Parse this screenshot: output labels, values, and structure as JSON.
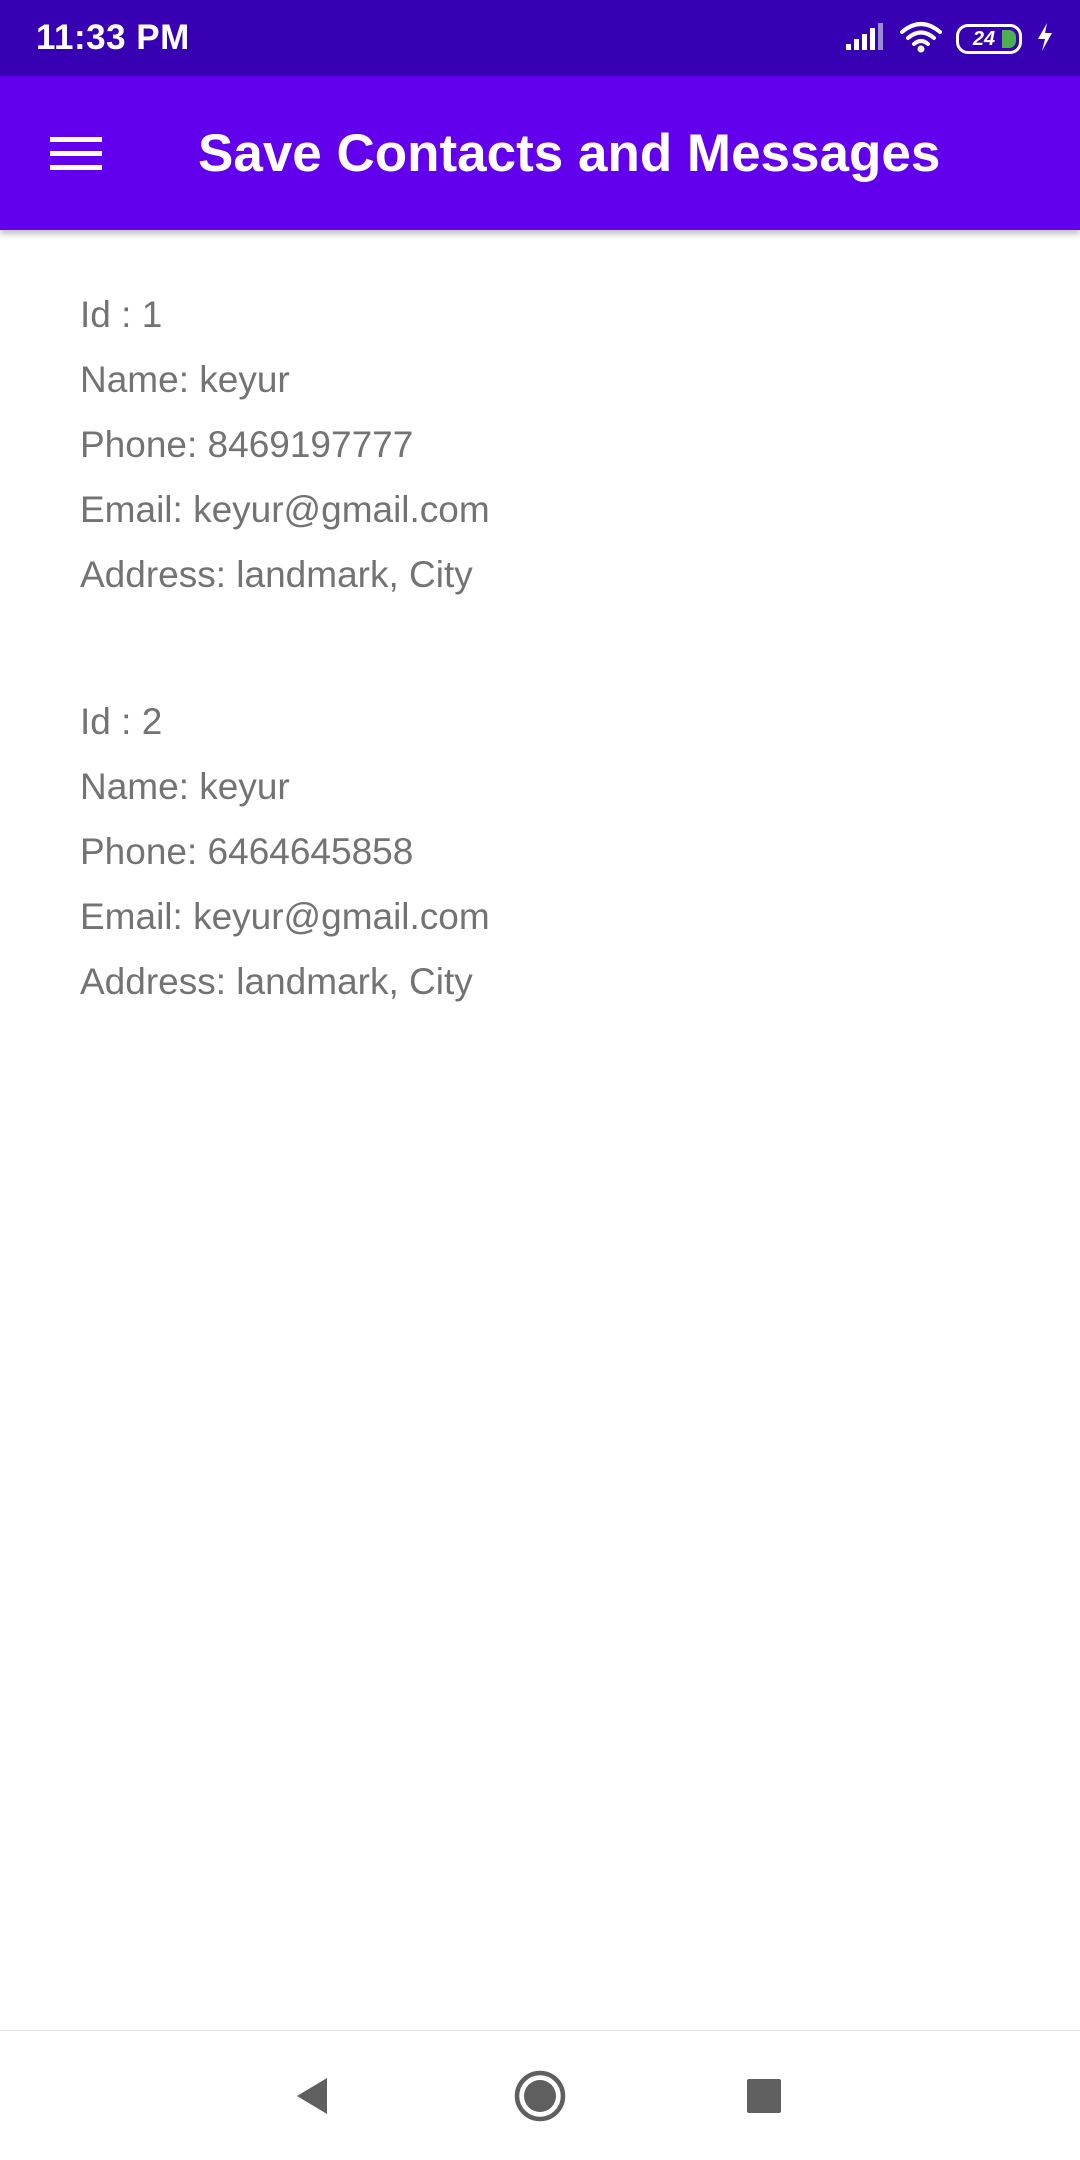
{
  "status_bar": {
    "time": "11:33 PM",
    "battery_level": "24",
    "icons": [
      "signal-icon",
      "wifi-icon",
      "battery-icon",
      "charging-icon"
    ]
  },
  "app_bar": {
    "title": "Save Contacts and Messages",
    "menu_icon": "hamburger-menu-icon"
  },
  "contacts": [
    {
      "id": "Id : 1",
      "name": "Name: keyur",
      "phone": "Phone: 8469197777",
      "email": "Email: keyur@gmail.com",
      "address": "Address: landmark, City"
    },
    {
      "id": "Id : 2",
      "name": "Name: keyur",
      "phone": "Phone: 6464645858",
      "email": "Email: keyur@gmail.com",
      "address": "Address: landmark, City"
    }
  ],
  "nav_bar": {
    "icons": [
      "back-icon",
      "home-icon",
      "recents-icon"
    ]
  },
  "colors": {
    "status_bar": "#3700B3",
    "app_bar": "#6200EE",
    "text": "#737373",
    "nav_icon": "#5f5f5f"
  }
}
